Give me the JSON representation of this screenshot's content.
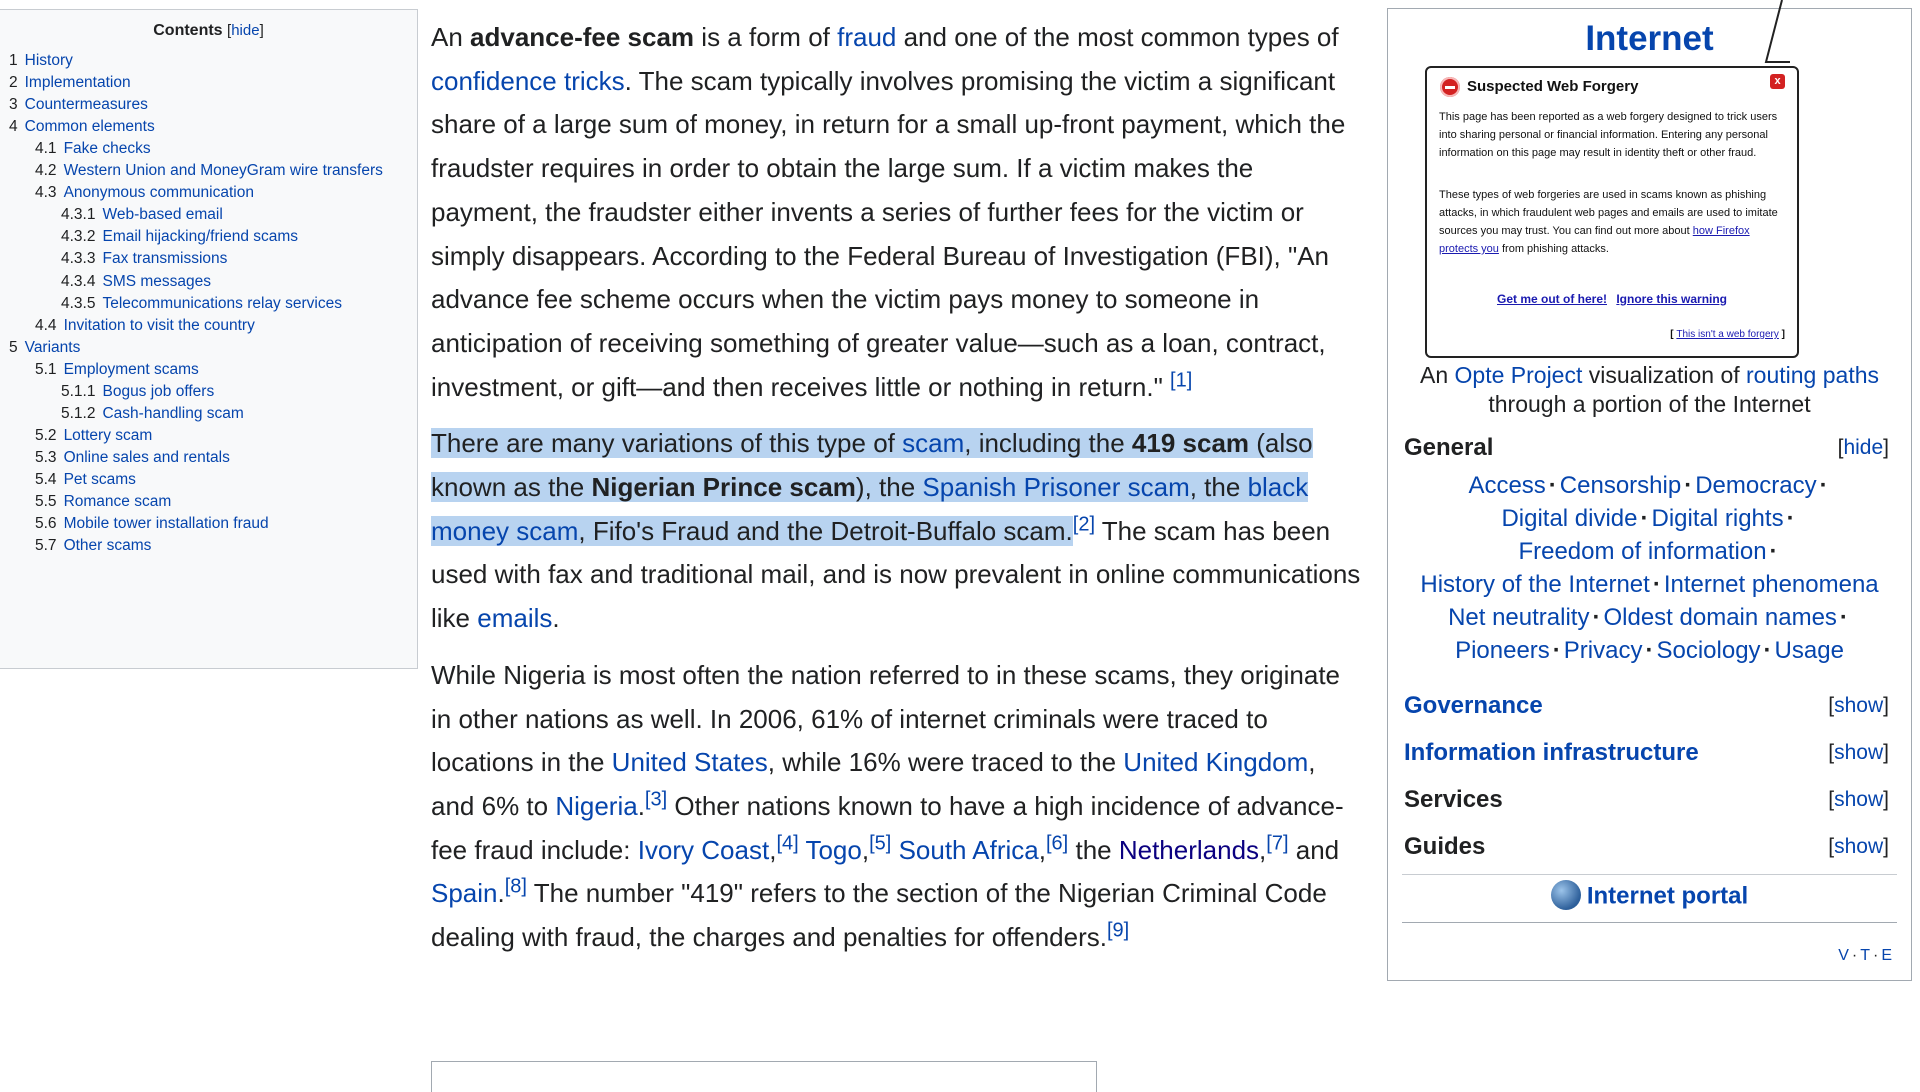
{
  "toc": {
    "title": "Contents",
    "hide": "[hide]",
    "items": [
      {
        "num": "1",
        "label": "History"
      },
      {
        "num": "2",
        "label": "Implementation"
      },
      {
        "num": "3",
        "label": "Countermeasures"
      },
      {
        "num": "4",
        "label": "Common elements"
      },
      {
        "num": "4.1",
        "label": "Fake checks"
      },
      {
        "num": "4.2",
        "label": "Western Union and MoneyGram wire transfers"
      },
      {
        "num": "4.3",
        "label": "Anonymous communication"
      },
      {
        "num": "4.3.1",
        "label": "Web-based email"
      },
      {
        "num": "4.3.2",
        "label": "Email hijacking/friend scams"
      },
      {
        "num": "4.3.3",
        "label": "Fax transmissions"
      },
      {
        "num": "4.3.4",
        "label": "SMS messages"
      },
      {
        "num": "4.3.5",
        "label": "Telecommunications relay services"
      },
      {
        "num": "4.4",
        "label": "Invitation to visit the country"
      },
      {
        "num": "5",
        "label": "Variants"
      },
      {
        "num": "5.1",
        "label": "Employment scams"
      },
      {
        "num": "5.1.1",
        "label": "Bogus job offers"
      },
      {
        "num": "5.1.2",
        "label": "Cash-handling scam"
      },
      {
        "num": "5.2",
        "label": "Lottery scam"
      },
      {
        "num": "5.3",
        "label": "Online sales and rentals"
      },
      {
        "num": "5.4",
        "label": "Pet scams"
      },
      {
        "num": "5.5",
        "label": "Romance scam"
      },
      {
        "num": "5.6",
        "label": "Mobile tower installation fraud"
      },
      {
        "num": "5.7",
        "label": "Other scams"
      }
    ]
  },
  "article": {
    "p1": {
      "t1": "An ",
      "b1": "advance-fee scam",
      "t2": " is a form of ",
      "l1": "fraud",
      "t3": " and one of the most common types of ",
      "l2": "confidence tricks",
      "t4": ". The scam typically involves promising the victim a significant share of a large sum of money, in return for a small up-front payment, which the fraudster requires in order to obtain the large sum. If a victim makes the payment, the fraudster either invents a series of further fees for the victim or simply disappears. According to the Federal Bureau of Investigation (FBI), \"An advance fee scheme occurs when the victim pays money to someone in anticipation of receiving something of greater value—such as a loan, contract, investment, or gift—and then receives little or nothing in return.\" ",
      "ref1": "[1]"
    },
    "p2": {
      "t1": "There are many variations of this type of ",
      "l1": "scam",
      "t2": ", including the ",
      "b1": "419 scam",
      "t3": " (also known as the ",
      "b2": "Nigerian Prince scam",
      "t4": "), the ",
      "l2": "Spanish Prisoner scam",
      "t5": ", the ",
      "l3": "black money scam",
      "t6": ", Fifo's Fraud and the Detroit-Buffalo scam.",
      "ref2": "[2]",
      "t7": " The scam has been used with fax and traditional mail, and is now prevalent in online communications like ",
      "l4": "emails",
      "t8": "."
    },
    "p3": {
      "t1": "While Nigeria is most often the nation referred to in these scams, they originate in other nations as well. In 2006, 61% of internet criminals were traced to locations in the ",
      "l1": "United States",
      "t2": ", while 16% were traced to the ",
      "l2": "United Kingdom",
      "t3": ", and 6% to ",
      "l3": "Nigeria",
      "t4": ".",
      "ref3": "[3]",
      "t5": " Other nations known to have a high incidence of advance-fee fraud include: ",
      "l4": "Ivory Coast",
      "t6": ",",
      "ref4": "[4]",
      "t7": " ",
      "l5": "Togo",
      "t8": ",",
      "ref5": "[5]",
      "t9": " ",
      "l6": "South Africa",
      "t10": ",",
      "ref6": "[6]",
      "t11": " the ",
      "l7": "Netherlands",
      "t12": ",",
      "ref7": "[7]",
      "t13": " and ",
      "l8": "Spain",
      "t14": ".",
      "ref8": "[8]",
      "t15": " The number \"419\" refers to the section of the Nigerian Criminal Code dealing with fraud, the charges and penalties for offenders.",
      "ref9": "[9]"
    }
  },
  "infobox": {
    "title": "Internet",
    "forgery": {
      "title": "Suspected Web Forgery",
      "close": "x",
      "p1": "This page has been reported as a web forgery designed to trick users into sharing personal or financial information. Entering any personal information on this page may result in identity theft or other fraud.",
      "p2a": "These types of web forgeries are used in scams known as phishing attacks, in which fraudulent web pages and emails are used to imitate sources you may trust. You can find out more about ",
      "p2link": "how Firefox protects you",
      "p2b": " from phishing attacks.",
      "action1": "Get me out of here!",
      "action2": "Ignore this warning",
      "small_open": "[ ",
      "small_link": "This isn't a web forgery",
      "small_close": " ]"
    },
    "caption": {
      "t1": "An ",
      "l1": "Opte Project",
      "t2": " visualization of ",
      "l2": "routing paths",
      "t3": " through a portion of the Internet"
    },
    "general": {
      "heading": "General",
      "toggle": "hide"
    },
    "general_items": [
      "Access",
      "Censorship",
      "Democracy",
      "Digital divide",
      "Digital rights",
      "Freedom of information",
      "History of the Internet",
      "Internet phenomena",
      "Net neutrality",
      "Oldest domain names",
      "Pioneers",
      "Privacy",
      "Sociology",
      "Usage"
    ],
    "sections": [
      {
        "heading": "Governance",
        "toggle": "show"
      },
      {
        "heading": "Information infrastructure",
        "toggle": "show"
      },
      {
        "heading": "Services",
        "toggle": "show"
      },
      {
        "heading": "Guides",
        "toggle": "show"
      }
    ],
    "portal": "Internet portal",
    "vte": {
      "v": "V",
      "t": "T",
      "e": "E"
    }
  }
}
